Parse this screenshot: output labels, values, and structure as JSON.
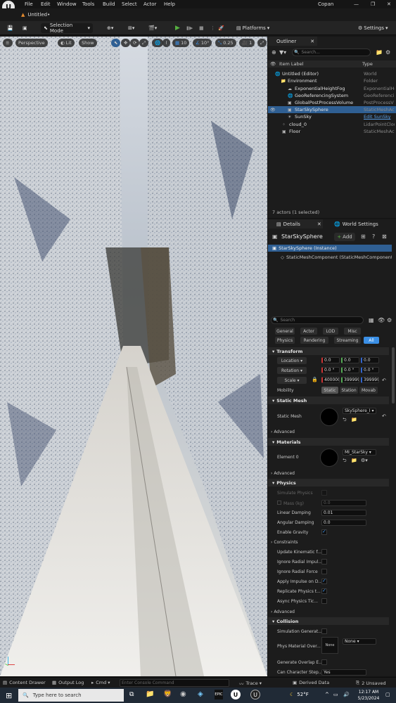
{
  "menu": [
    "File",
    "Edit",
    "Window",
    "Tools",
    "Build",
    "Select",
    "Actor",
    "Help"
  ],
  "project_name": "Copan",
  "tab_title": "Untitled•",
  "toolbar": {
    "selection_mode": "Selection Mode",
    "platforms": "Platforms",
    "settings": "Settings"
  },
  "viewport": {
    "perspective": "Perspective",
    "lit": "Lit",
    "show": "Show",
    "grid": "10",
    "angle": "10°",
    "scale": "0.25",
    "speed": "1"
  },
  "outliner": {
    "tab": "Outliner",
    "search_placeholder": "Search...",
    "col_label": "Item Label",
    "col_type": "Type",
    "items": [
      {
        "label": "Untitled (Editor)",
        "type": "World"
      },
      {
        "label": "Environment",
        "type": "Folder"
      },
      {
        "label": "ExponentialHeightFog",
        "type": "ExponentialHe"
      },
      {
        "label": "GeoReferencingSystem",
        "type": "GeoReferencin"
      },
      {
        "label": "GlobalPostProcessVolume",
        "type": "PostProcessV"
      },
      {
        "label": "StarSkySphere",
        "type": "StaticMeshAct"
      },
      {
        "label": "SunSky",
        "type": "Edit SunSky"
      },
      {
        "label": "cloud_0",
        "type": "LidarPointClou"
      },
      {
        "label": "Floor",
        "type": "StaticMeshAct"
      }
    ],
    "footer": "7 actors (1 selected)"
  },
  "details": {
    "tab": "Details",
    "tab2": "World Settings",
    "actor": "StarSkySphere",
    "add": "Add",
    "instance": "StarSkySphere (Instance)",
    "component": "StaticMeshComponent (StaticMeshComponent0)",
    "search_placeholder": "Search",
    "filters_row1": [
      "General",
      "Actor",
      "LOD",
      "Misc"
    ],
    "filters_row2": [
      "Physics",
      "Rendering",
      "Streaming",
      "All"
    ],
    "transform": "Transform",
    "location": "Location",
    "loc": [
      "0.0",
      "0.0",
      "0.0"
    ],
    "rotation": "Rotation",
    "rot": [
      "0.0 °",
      "0.0 °",
      "0.0 °"
    ],
    "scale": "Scale",
    "scl": [
      "400000",
      "399999",
      "399999"
    ],
    "mobility": "Mobility",
    "mob": [
      "Static",
      "Station",
      "Movab"
    ],
    "static_mesh_sec": "Static Mesh",
    "static_mesh": "Static Mesh",
    "mesh_value": "SkySphere_I",
    "advanced": "Advanced",
    "materials_sec": "Materials",
    "element0": "Element 0",
    "material_value": "MI_StarSky",
    "physics_sec": "Physics",
    "simulate": "Simulate Physics",
    "mass": "Mass (kg)",
    "mass_value": "0.0",
    "lin_damp": "Linear Damping",
    "lin_value": "0.01",
    "ang_damp": "Angular Damping",
    "ang_value": "0.0",
    "gravity": "Enable Gravity",
    "constraints": "Constraints",
    "kinematic": "Update Kinematic f...",
    "radial_impulse": "Ignore Radial Impul...",
    "radial_force": "Ignore Radial Force",
    "apply_impulse": "Apply Impulse on D...",
    "replicate": "Replicate Physics t...",
    "async": "Async Physics Tic...",
    "collision_sec": "Collision",
    "sim_gen": "Simulation Generat...",
    "phys_mat": "Phys Material Over...",
    "none": "None",
    "overlap": "Generate Overlap E...",
    "char_step": "Can Character Step...",
    "yes": "Yes"
  },
  "status": {
    "content_drawer": "Content Drawer",
    "output_log": "Output Log",
    "cmd": "Cmd",
    "console_placeholder": "Enter Console Command",
    "trace": "Trace",
    "derived": "Derived Data",
    "unsaved": "2 Unsaved"
  },
  "taskbar": {
    "search": "Type here to search",
    "weather": "52°F",
    "time": "12:17 AM",
    "date": "5/23/2024"
  },
  "colors": {
    "accent": "#3b8fe5",
    "selected": "#2f5f93",
    "play": "#56b140"
  }
}
